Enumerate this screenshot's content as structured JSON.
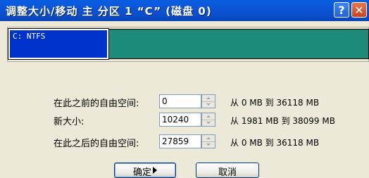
{
  "window": {
    "title": "调整大小/移动 主 分区 1 “C” (磁盘 0)",
    "help_glyph": "?",
    "close_glyph": "✕"
  },
  "partition": {
    "label": "C: NTFS",
    "used_color": "#0033cc",
    "free_color": "#1e8a78"
  },
  "fields": [
    {
      "label": "在此之前的自由空间:",
      "value": "0",
      "range": "从 0 MB 到 36118 MB"
    },
    {
      "label": "新大小:",
      "value": "10240",
      "range": "从 1981 MB 到 38099 MB"
    },
    {
      "label": "在此之后的自由空间:",
      "value": "27859",
      "range": "从 0 MB 到 36118 MB"
    }
  ],
  "buttons": {
    "ok_label": "确定",
    "cancel_label": "取消"
  }
}
